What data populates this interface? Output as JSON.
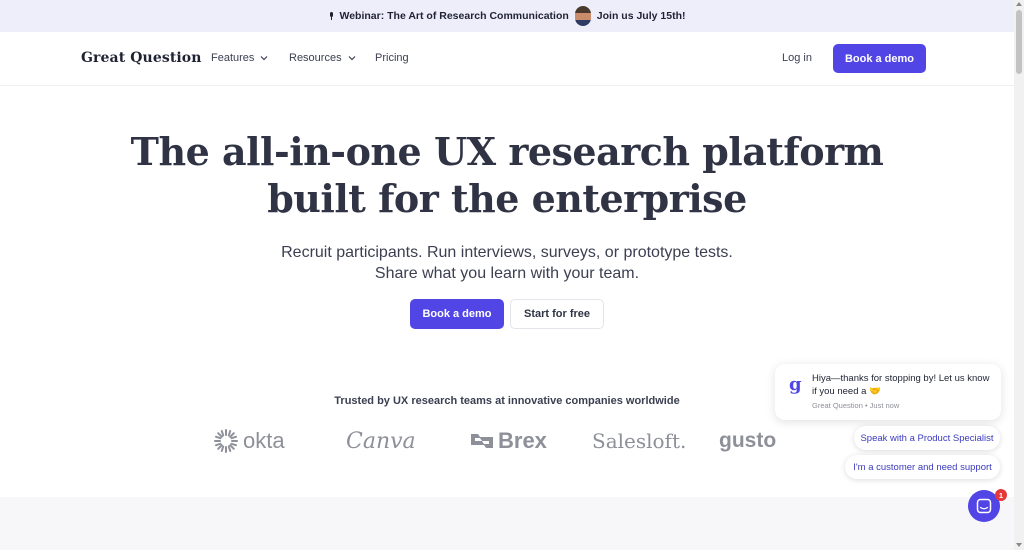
{
  "banner": {
    "text_before": "Webinar: The Art of Research Communication",
    "text_after": "Join us July 15th!",
    "icon": "microphone-icon"
  },
  "nav": {
    "logo": "Great Question",
    "features": "Features",
    "resources": "Resources",
    "pricing": "Pricing",
    "login": "Log in",
    "book_demo": "Book a demo"
  },
  "hero": {
    "title_line1": "The all-in-one UX research platform",
    "title_line2": "built for the enterprise",
    "sub_line1": "Recruit participants. Run interviews, surveys, or prototype tests.",
    "sub_line2": "Share what you learn with your team.",
    "primary_cta": "Book a demo",
    "secondary_cta": "Start for free"
  },
  "trusted": {
    "heading": "Trusted by UX research teams at innovative companies worldwide",
    "brands": [
      "okta",
      "Canva",
      "Brex",
      "Salesloft.",
      "gusto"
    ]
  },
  "chat": {
    "avatar_letter": "g",
    "message": "Hiya—thanks for stopping by! Let us know if you need a 🤝",
    "sender": "Great Question",
    "time": "Just now",
    "chip_1": "Speak with a Product Specialist",
    "chip_2": "I'm a customer and need support",
    "badge_count": "1"
  },
  "colors": {
    "accent": "#5146e5",
    "heading": "#2f3344",
    "banner_bg": "#eeeefb",
    "logo_gray": "#8e9099",
    "badge_red": "#e5383b"
  }
}
